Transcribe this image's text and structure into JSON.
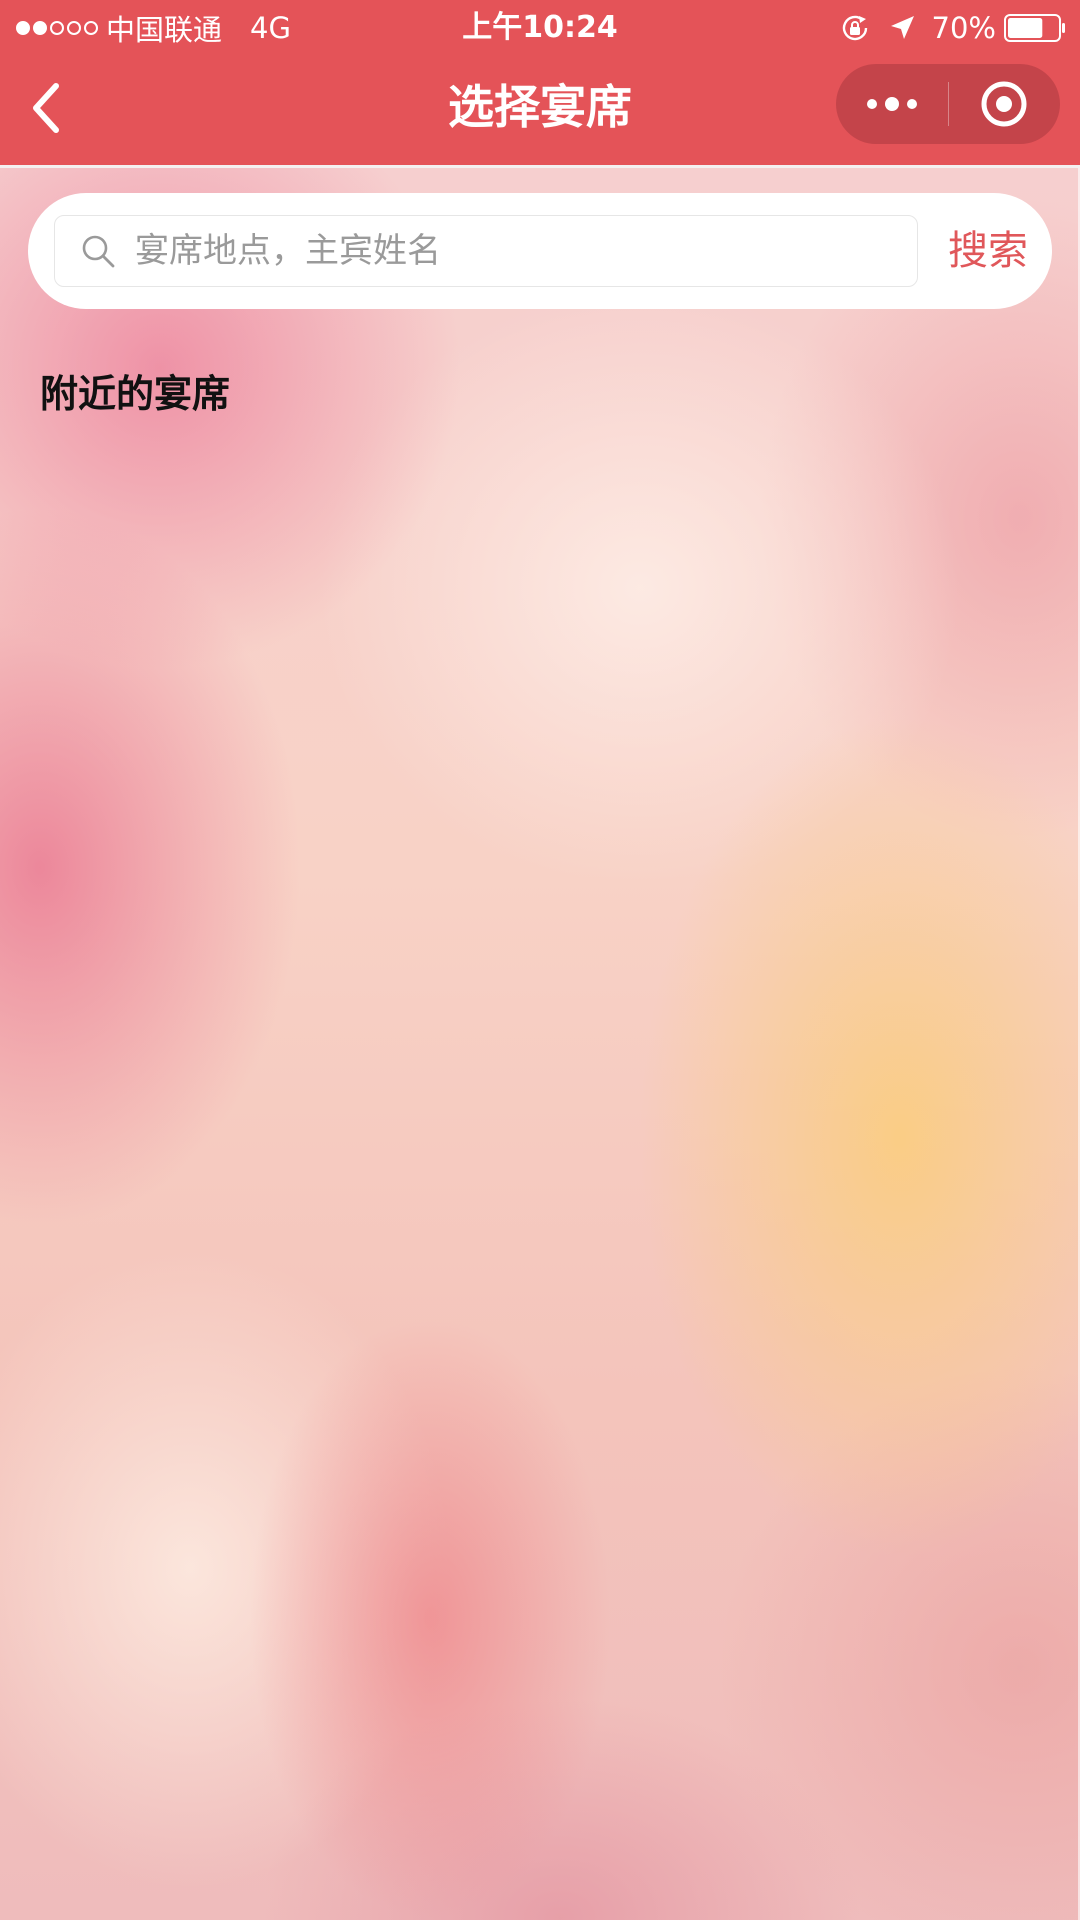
{
  "status_bar": {
    "carrier": "中国联通",
    "network": "4G",
    "time": "上午10:24",
    "battery": "70%",
    "signal_level": 2,
    "signal_total": 5,
    "battery_level": 0.7,
    "icons": [
      "rotation-lock-icon",
      "location-arrow-icon",
      "battery-icon"
    ]
  },
  "nav": {
    "title": "选择宴席",
    "back_icon": "chevron-left-icon",
    "menu_icon": "more-dots-icon",
    "close_icon": "target-circle-icon"
  },
  "search": {
    "placeholder": "宴席地点，主宾姓名",
    "value": "",
    "button_label": "搜索",
    "icon": "search-icon"
  },
  "section": {
    "title": "附近的宴席"
  },
  "colors": {
    "header": "#e45358",
    "capsule": "#c4444a",
    "accent": "#e0575a",
    "title_text": "#111111",
    "placeholder": "#9a9a9a"
  }
}
